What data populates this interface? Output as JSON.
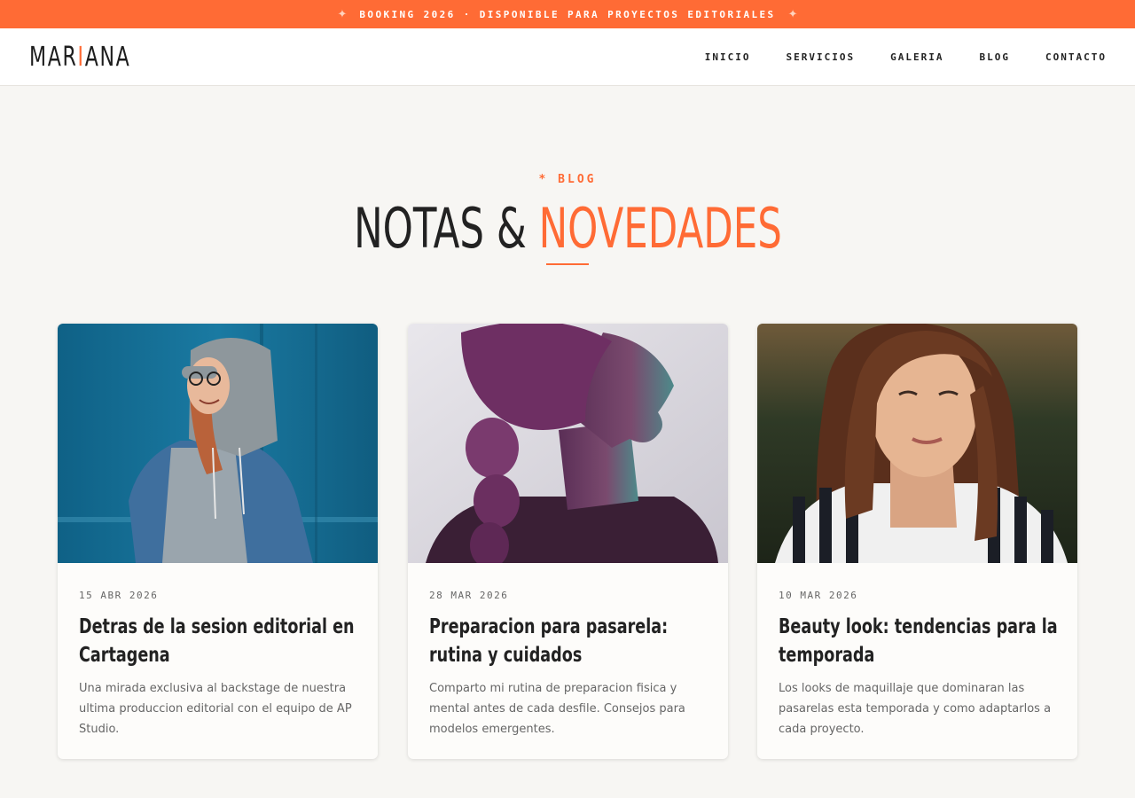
{
  "banner": {
    "text": "BOOKING 2026 · DISPONIBLE PARA PROYECTOS EDITORIALES",
    "star_icon": "sparkle-icon"
  },
  "header": {
    "logo": {
      "before": "MAR",
      "accent": "I",
      "after": "ANA"
    },
    "nav": [
      "INICIO",
      "SERVICIOS",
      "GALERIA",
      "BLOG",
      "CONTACTO"
    ]
  },
  "section": {
    "eyebrow": "* BLOG",
    "title_part1": "NOTAS & ",
    "title_part2": "NOVEDADES"
  },
  "posts": [
    {
      "date": "15 ABR 2026",
      "title": "Detras de la sesion editorial en Cartagena",
      "excerpt": "Una mirada exclusiva al backstage de nuestra ultima produccion editorial con el equipo de AP Studio.",
      "image": "woman-in-hoodie-photo"
    },
    {
      "date": "28 MAR 2026",
      "title": "Preparacion para pasarela: rutina y cuidados",
      "excerpt": "Comparto mi rutina de preparacion fisica y mental antes de cada desfile. Consejos para modelos emergentes.",
      "image": "profile-portrait-photo"
    },
    {
      "date": "10 MAR 2026",
      "title": "Beauty look: tendencias para la temporada",
      "excerpt": "Los looks de maquillaje que dominaran las pasarelas esta temporada y como adaptarlos a cada proyecto.",
      "image": "beauty-portrait-photo"
    }
  ],
  "colors": {
    "accent": "#ff6b35",
    "background": "#f7f6f3",
    "text": "#222222"
  }
}
